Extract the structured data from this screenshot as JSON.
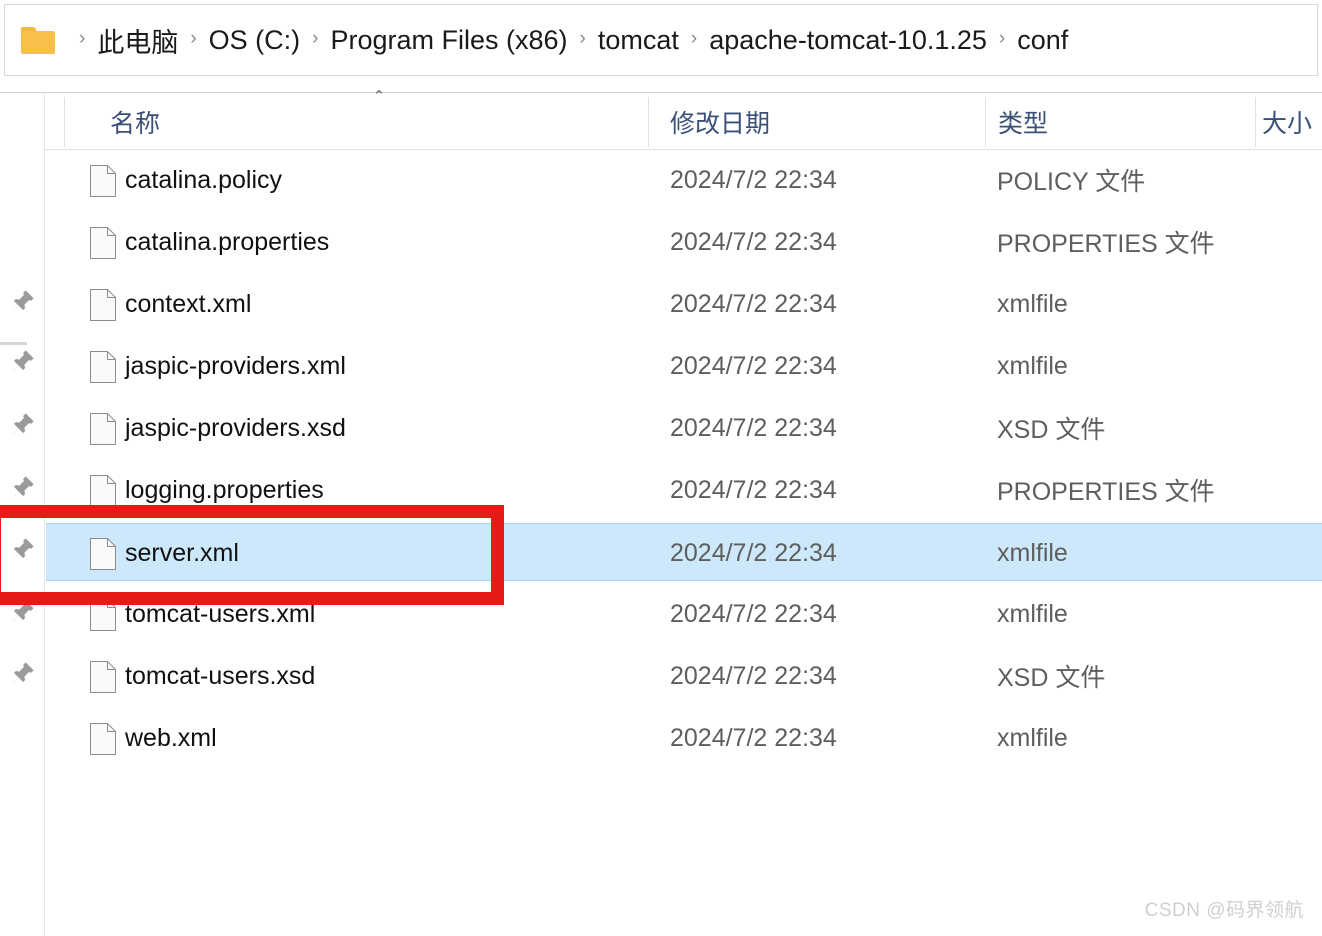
{
  "window": {
    "type": "file-explorer",
    "theme_accent": "#3b5077",
    "selection_color": "#cce8fa",
    "selection_border": "#a6d8f5",
    "annotation_color": "#e41b17"
  },
  "addressbar": {
    "folder_icon": "folder-icon",
    "separator": "›",
    "crumbs": [
      "此电脑",
      "OS (C:)",
      "Program Files (x86)",
      "tomcat",
      "apache-tomcat-10.1.25",
      "conf"
    ]
  },
  "columns": {
    "sort_caret": "⌃",
    "headers": [
      {
        "label": "名称",
        "key": "name"
      },
      {
        "label": "修改日期",
        "key": "date"
      },
      {
        "label": "类型",
        "key": "type"
      },
      {
        "label": "大小",
        "key": "size"
      }
    ]
  },
  "sidebar": {
    "pins": [
      "pin-icon",
      "pin-icon",
      "pin-icon",
      "pin-icon",
      "pin-icon",
      "pin-icon",
      "pin-icon"
    ]
  },
  "files": [
    {
      "name": "catalina.policy",
      "date": "2024/7/2 22:34",
      "type": "POLICY 文件",
      "size": "",
      "selected": false
    },
    {
      "name": "catalina.properties",
      "date": "2024/7/2 22:34",
      "type": "PROPERTIES 文件",
      "size": "",
      "selected": false
    },
    {
      "name": "context.xml",
      "date": "2024/7/2 22:34",
      "type": "xmlfile",
      "size": "",
      "selected": false
    },
    {
      "name": "jaspic-providers.xml",
      "date": "2024/7/2 22:34",
      "type": "xmlfile",
      "size": "",
      "selected": false
    },
    {
      "name": "jaspic-providers.xsd",
      "date": "2024/7/2 22:34",
      "type": "XSD 文件",
      "size": "",
      "selected": false
    },
    {
      "name": "logging.properties",
      "date": "2024/7/2 22:34",
      "type": "PROPERTIES 文件",
      "size": "",
      "selected": false
    },
    {
      "name": "server.xml",
      "date": "2024/7/2 22:34",
      "type": "xmlfile",
      "size": "",
      "selected": true
    },
    {
      "name": "tomcat-users.xml",
      "date": "2024/7/2 22:34",
      "type": "xmlfile",
      "size": "",
      "selected": false
    },
    {
      "name": "tomcat-users.xsd",
      "date": "2024/7/2 22:34",
      "type": "XSD 文件",
      "size": "",
      "selected": false
    },
    {
      "name": "web.xml",
      "date": "2024/7/2 22:34",
      "type": "xmlfile",
      "size": "",
      "selected": false
    }
  ],
  "annotation": {
    "target_file": "server.xml",
    "shape": "rectangle"
  },
  "watermark": {
    "text": "CSDN @码界领航"
  }
}
